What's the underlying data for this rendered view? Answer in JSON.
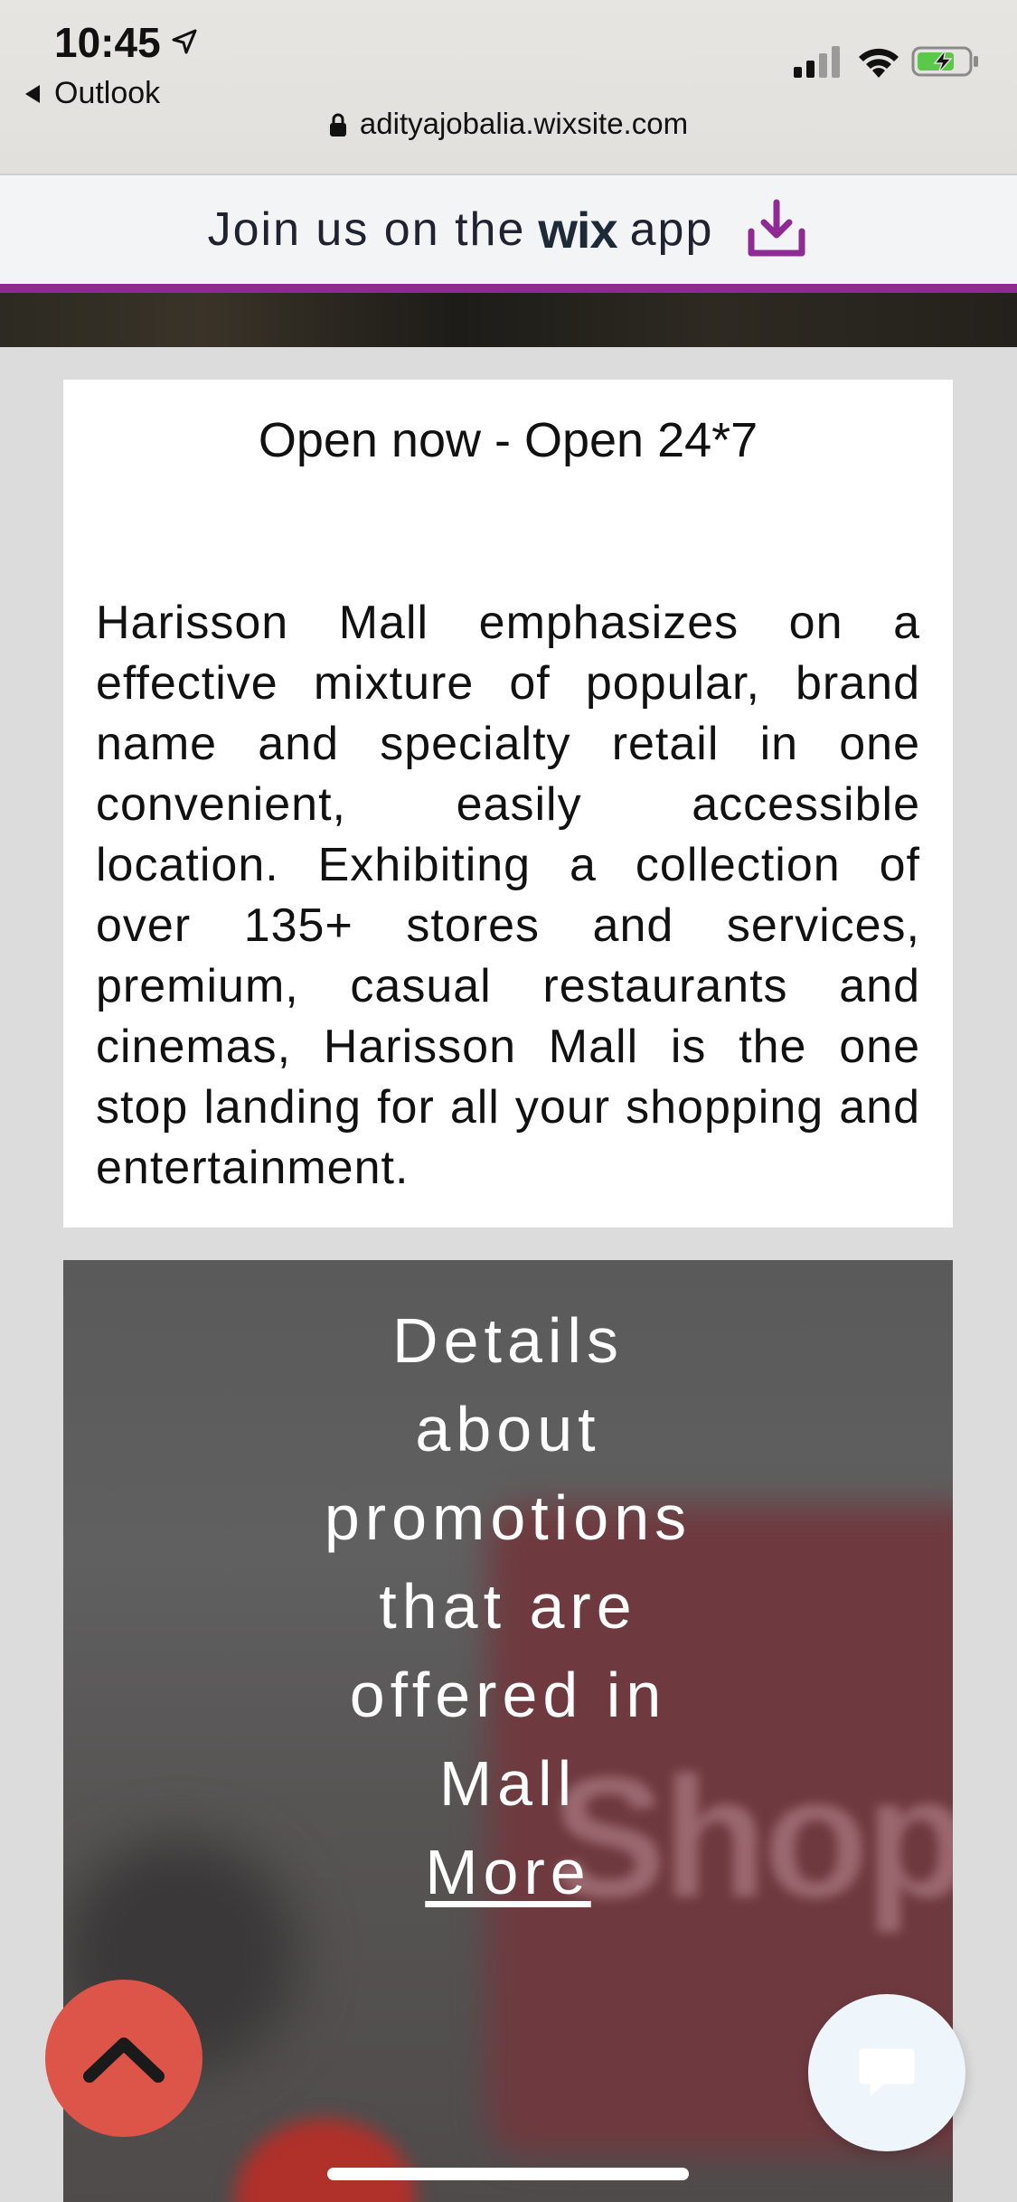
{
  "status_bar": {
    "time": "10:45",
    "back_app": "Outlook",
    "url": "adityajobalia.wixsite.com"
  },
  "wix_banner": {
    "text_before": "Join us on the",
    "logo": "wix",
    "text_after": "app",
    "icon": "download-icon",
    "accent_color": "#8e2a94"
  },
  "info": {
    "open_status": "Open now - Open 24*7",
    "description": "Harisson Mall emphasizes on a effective mixture of popular, brand name and specialty retail in one convenient, easily accessible location. Exhibiting a collection of over 135+ stores and services, premium, casual restaurants and cinemas, Harisson Mall is the one stop landing for all your shopping and entertainment."
  },
  "promo": {
    "lines": [
      "Details",
      "about",
      "promotions",
      "that are",
      "offered in",
      "Mall"
    ],
    "more_link": "More",
    "background_text": "Shop"
  },
  "floating": {
    "scroll_top_icon": "chevron-up-icon",
    "scroll_top_color": "#dd5448",
    "chat_icon": "chat-bubble-icon"
  }
}
